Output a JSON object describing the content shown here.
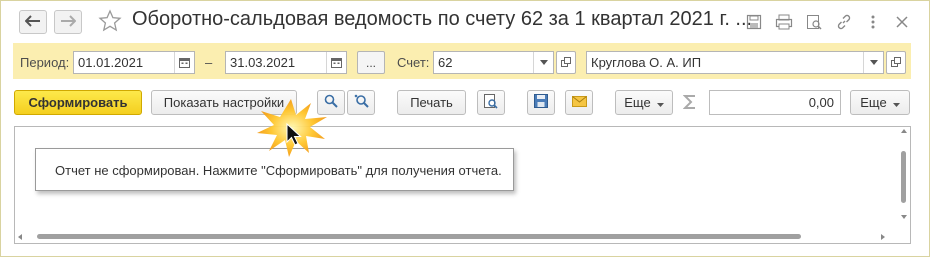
{
  "window": {
    "title": "Оборотно-сальдовая ведомость по счету 62 за 1 квартал 2021 г. ...",
    "back_icon": "arrow-left-icon",
    "forward_icon": "arrow-right-icon",
    "favorite_icon": "star-icon",
    "tools": [
      "save-icon",
      "print-icon",
      "preview-icon",
      "link-icon",
      "more-vertical-icon",
      "close-icon"
    ]
  },
  "params": {
    "period_label": "Период:",
    "date_from": "01.01.2021",
    "dash": "–",
    "date_to": "31.03.2021",
    "period_select_label": "...",
    "account_label": "Счет:",
    "account_value": "62",
    "organization_value": "Круглова О. А. ИП"
  },
  "toolbar": {
    "generate_label": "Сформировать",
    "settings_label": "Показать настройки",
    "print_label": "Печать",
    "more_label_1": "Еще",
    "sum_value": "0,00",
    "more_label_2": "Еще"
  },
  "report": {
    "message": "Отчет не сформирован. Нажмите \"Сформировать\" для получения отчета."
  },
  "colors": {
    "param_band": "#fbeeb0",
    "primary_button": "#f4cf1f",
    "frame_border": "#d9d3a0"
  }
}
